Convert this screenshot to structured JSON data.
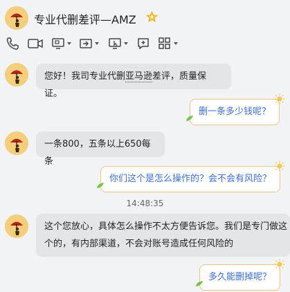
{
  "header": {
    "title": "专业代删差评—AMZ",
    "star_color": "#f0b92a"
  },
  "toolbar": {
    "items": [
      "phone-icon",
      "video-icon",
      "screen-share-icon",
      "transfer-file-icon",
      "remote-desktop-icon",
      "add-message-icon",
      "apps-icon"
    ]
  },
  "messages": [
    {
      "side": "in",
      "text_a": "您好！我司专业代删",
      "text_b": "亚马逊",
      "text_c": "差评，质量保证。"
    },
    {
      "side": "out",
      "text": "删一条多少钱呢？"
    },
    {
      "side": "in",
      "text": "一条800，五条以上650每条"
    },
    {
      "side": "out",
      "text": "你们这个是怎么操作的？会不会有风险？"
    },
    {
      "side": "time",
      "text": "14:48:35"
    },
    {
      "side": "in",
      "text_line1": "这个您放心，具体怎么操作不太方便告诉您。我们是专门做这",
      "text_line2": "个的，有内部渠道，不会对账号造成任何风险的"
    },
    {
      "side": "out",
      "text": "多久能删掉呢？"
    }
  ]
}
